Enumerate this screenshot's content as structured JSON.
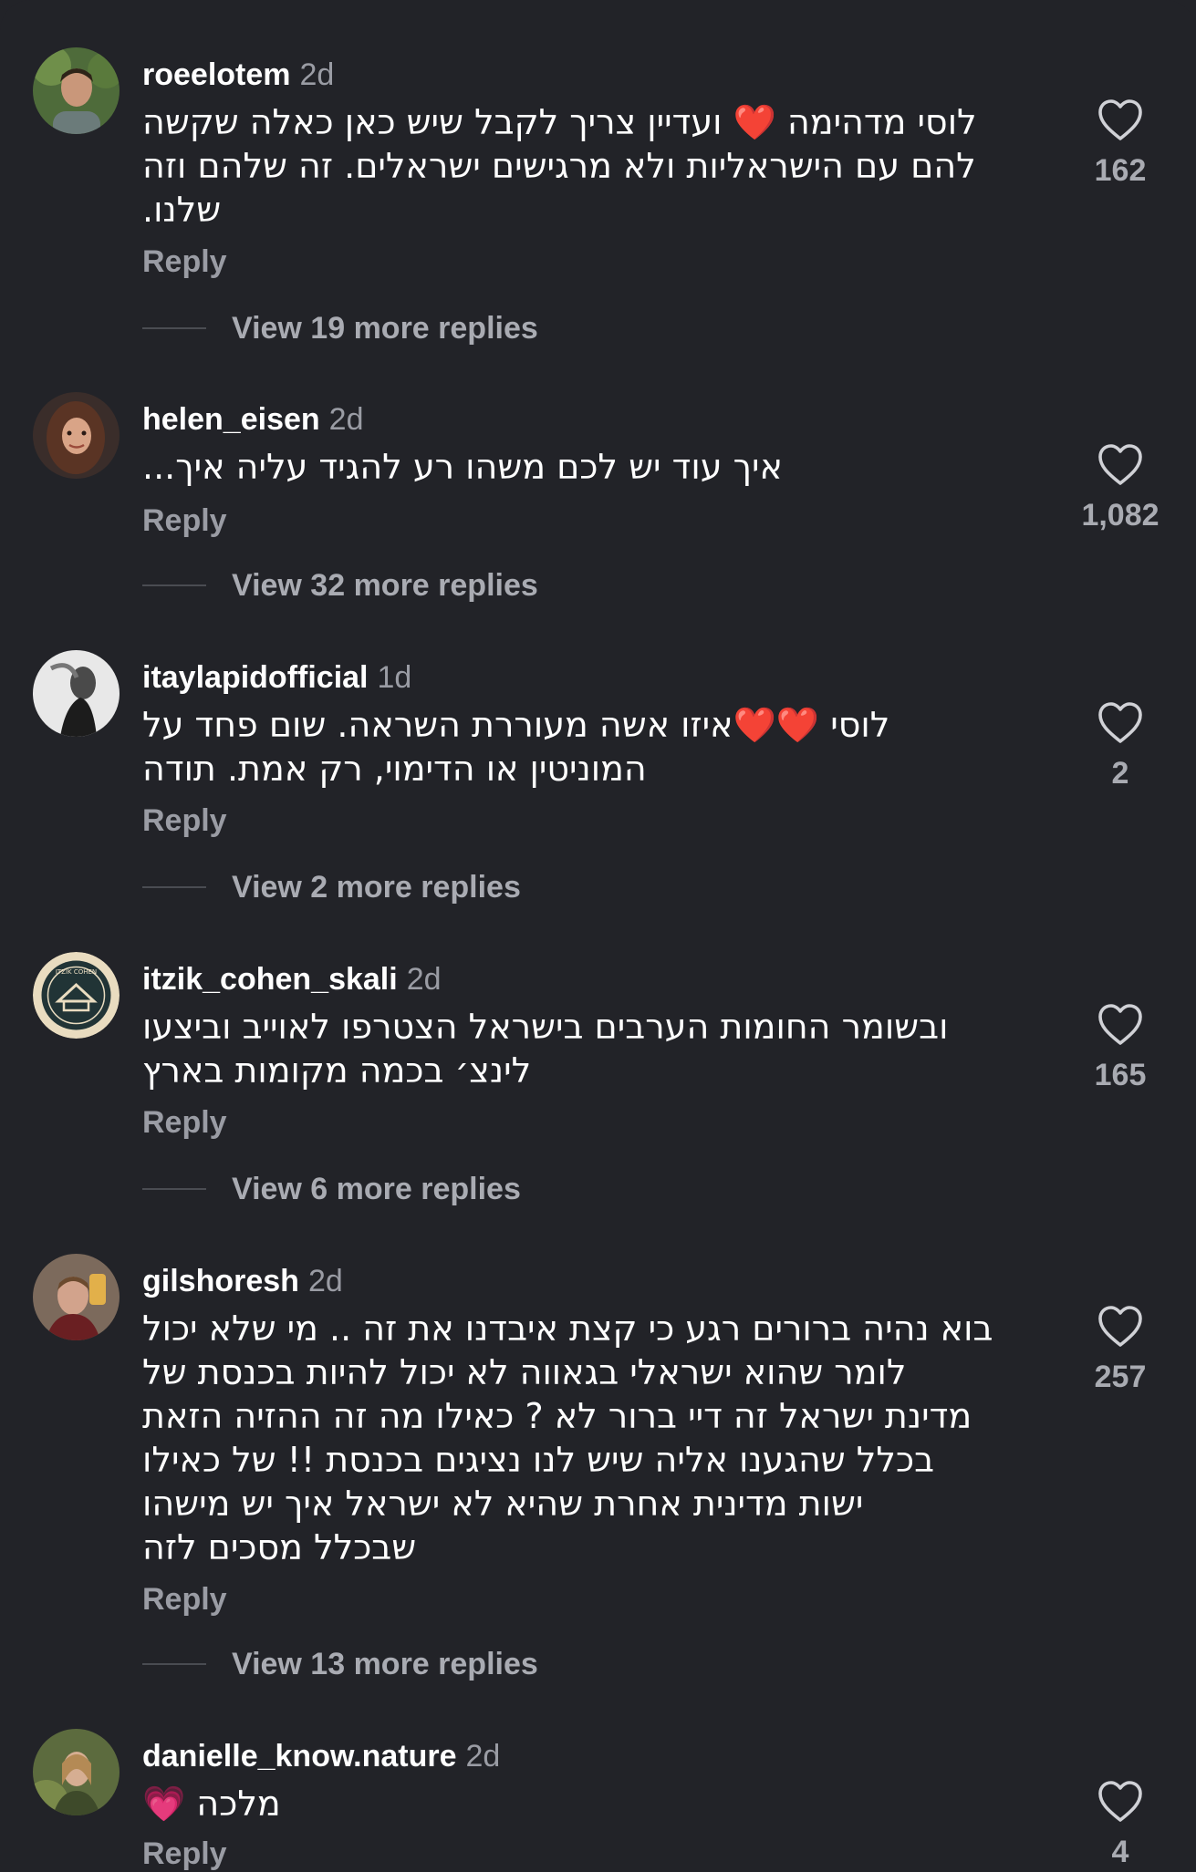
{
  "comments": [
    {
      "username": "roeelotem",
      "time": "2d",
      "lines": [
        "לוסי מדהימה ❤️ ועדיין צריך לקבל שיש כאן כאלה שקשה",
        "להם עם הישראליות ולא מרגישים ישראלים. זה שלהם וזה",
        "שלנו."
      ],
      "reply_label": "Reply",
      "more_replies": "View 19 more replies",
      "likes": "162"
    },
    {
      "username": "helen_eisen",
      "time": "2d",
      "lines": [
        "איך עוד יש לכם משהו רע להגיד עליה איך..."
      ],
      "reply_label": "Reply",
      "more_replies": "View 32 more replies",
      "likes": "1,082"
    },
    {
      "username": "itaylapidofficial",
      "time": "1d",
      "lines": [
        "לוסי ❤️❤️איזו אשה מעוררת השראה. שום פחד על",
        "המוניטין או הדימוי, רק אמת. תודה"
      ],
      "reply_label": "Reply",
      "more_replies": "View 2 more replies",
      "likes": "2"
    },
    {
      "username": "itzik_cohen_skali",
      "time": "2d",
      "lines": [
        "ובשומר החומות הערבים בישראל הצטרפו לאוייב וביצעו",
        "לינצ׳ בכמה מקומות בארץ"
      ],
      "reply_label": "Reply",
      "more_replies": "View 6 more replies",
      "likes": "165"
    },
    {
      "username": "gilshoresh",
      "time": "2d",
      "lines": [
        "בוא נהיה ברורים רגע כי קצת איבדנו את זה .. מי שלא יכול",
        "לומר שהוא ישראלי בגאווה לא יכול להיות בכנסת של",
        "מדינת ישראל זה דיי ברור לא ? כאילו מה זה ההזיה הזאת",
        "בכלל שהגענו אליה שיש לנו נציגים בכנסת !! של כאילו",
        "ישות מדינית אחרת שהיא לא ישראל איך יש מישהו",
        "שבכלל מסכים לזה"
      ],
      "reply_label": "Reply",
      "more_replies": "View 13 more replies",
      "likes": "257"
    },
    {
      "username": "danielle_know.nature",
      "time": "2d",
      "lines": [
        "מלכה 💗"
      ],
      "reply_label": "Reply",
      "more_replies": "",
      "likes": "4"
    }
  ]
}
